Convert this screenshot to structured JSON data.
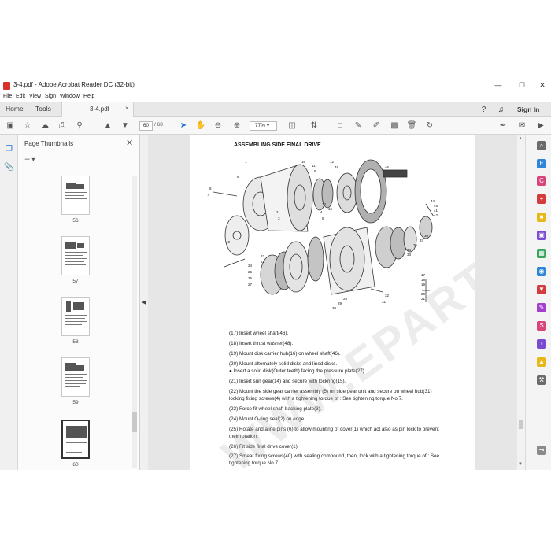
{
  "window": {
    "title": "3-4.pdf - Adobe Acrobat Reader DC (32-bit)",
    "minimize": "—",
    "maximize": "☐",
    "close": "✕"
  },
  "menu": [
    "File",
    "Edit",
    "View",
    "Sign",
    "Window",
    "Help"
  ],
  "tabs": {
    "home": "Home",
    "tools": "Tools",
    "document": "3-4.pdf",
    "document_close": "×",
    "sign_in": "Sign In"
  },
  "toolbar": {
    "current_page": "60",
    "total_pages": "/ 68",
    "zoom": "77%"
  },
  "thumbnails": {
    "title": "Page Thumbnails",
    "close": "✕",
    "options": "☰ ▾",
    "pages": [
      {
        "number": "56",
        "selected": false
      },
      {
        "number": "57",
        "selected": false
      },
      {
        "number": "58",
        "selected": false
      },
      {
        "number": "59",
        "selected": false
      },
      {
        "number": "60",
        "selected": true
      }
    ]
  },
  "document": {
    "heading": "ASSEMBLING SIDE FINAL DRIVE",
    "watermark": "WWW.EPARTS.COM",
    "steps": [
      "(17) Insert wheel shaft(46).",
      "(18) Insert thrust washer(48).",
      "(19) Mount disk carrier hub(16) on wheel shaft(46).",
      "(20) Mount alternately solid disks and lined disks.",
      "   ●  Insert a solid disk(Outer teeth) facing the pressure plate(27).",
      "(21) Insert sun gear(14) and secure with lockring(15).",
      "(22) Mount the side gear carrier assembly (5) on side gear unit and secure on wheel hub(31) locking fixing screws(4) with a tightening torque of : See tightening torque No.7.",
      "(23) Force fit wheel shaft backing plate(3).",
      "(24) Mount O-ring seal(2) on edge.",
      "(25) Rotate and aline pins (6) to allow mounting of cover(1) which act also as pin lock to prevent their rotation.",
      "(26) Fit side final drive cover(1).",
      "(27) Smear fixing screws(40) with sealing compound, then, lock with a tightening torque of : See tightening torque No.7."
    ],
    "callouts": [
      "46",
      "48",
      "16",
      "11",
      "12",
      "9",
      "1",
      "6",
      "8",
      "7",
      "40",
      "2",
      "3",
      "4",
      "14",
      "15",
      "5",
      "44",
      "45",
      "41",
      "42",
      "36",
      "37",
      "35",
      "34",
      "33",
      "28",
      "29",
      "30",
      "32",
      "31",
      "17",
      "18",
      "19",
      "20",
      "21",
      "24",
      "25",
      "26",
      "27",
      "22",
      "23"
    ]
  }
}
